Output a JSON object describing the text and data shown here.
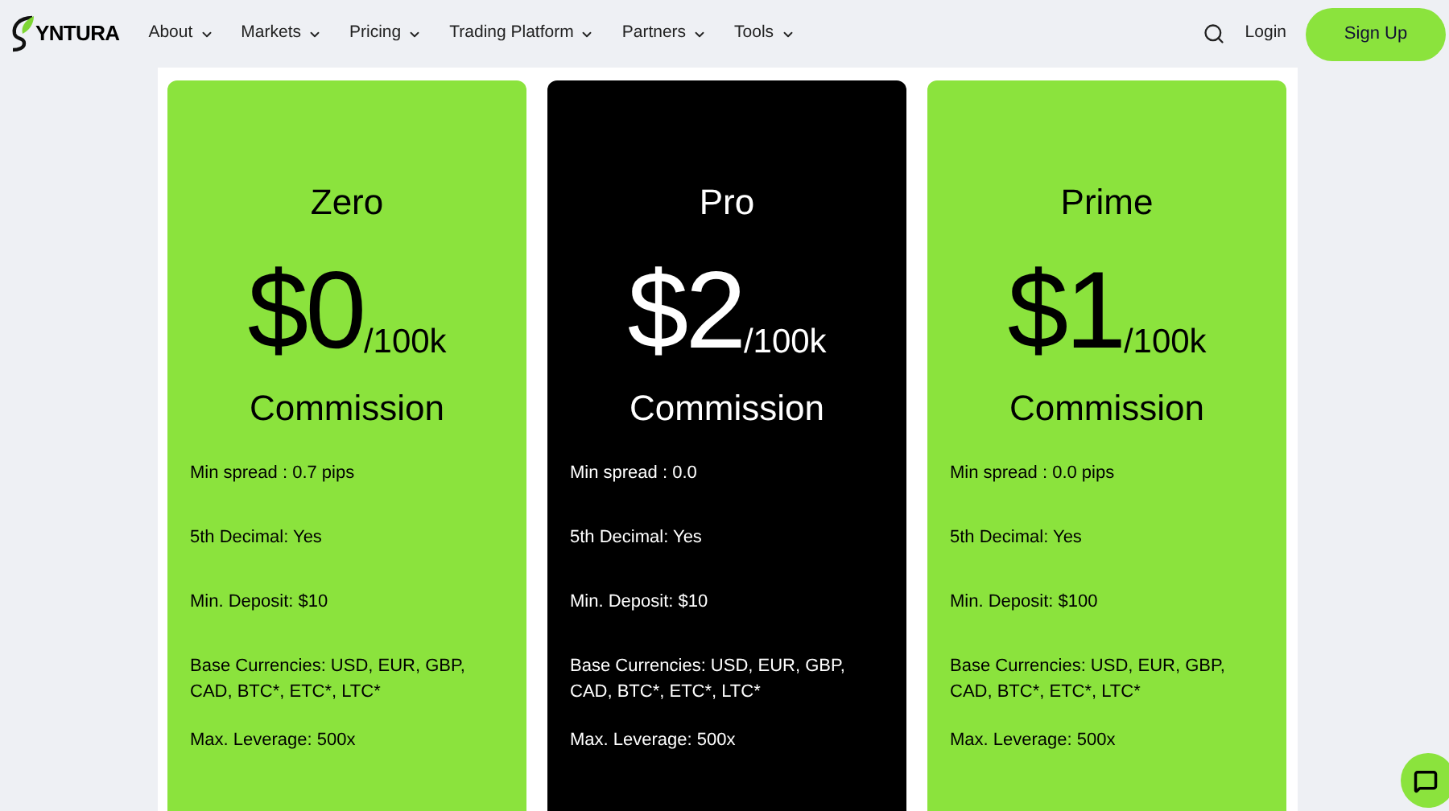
{
  "nav": {
    "logo": "YNTURA",
    "menu": [
      {
        "label": "About"
      },
      {
        "label": "Markets"
      },
      {
        "label": "Pricing"
      },
      {
        "label": "Trading Platform"
      },
      {
        "label": "Partners"
      },
      {
        "label": "Tools"
      }
    ],
    "login": "Login",
    "signup": "Sign Up"
  },
  "plans": [
    {
      "name": "Zero",
      "price": "$0",
      "unit": "/100k",
      "caption": "Commission",
      "featured": false,
      "features": [
        "Min spread : 0.7 pips",
        "5th Decimal: Yes",
        "Min. Deposit: $10",
        "Base Currencies: USD, EUR, GBP, CAD, BTC*, ETC*, LTC*",
        "Max. Leverage: 500x"
      ]
    },
    {
      "name": "Pro",
      "price": "$2",
      "unit": "/100k",
      "caption": "Commission",
      "featured": true,
      "features": [
        "Min spread : 0.0",
        "5th Decimal: Yes",
        "Min. Deposit: $10",
        "Base Currencies: USD, EUR, GBP, CAD, BTC*, ETC*, LTC*",
        "Max. Leverage: 500x"
      ]
    },
    {
      "name": "Prime",
      "price": "$1",
      "unit": "/100k",
      "caption": "Commission",
      "featured": false,
      "features": [
        "Min spread : 0.0 pips",
        "5th Decimal: Yes",
        "Min. Deposit: $100",
        "Base Currencies: USD, EUR, GBP, CAD, BTC*, ETC*, LTC*",
        "Max. Leverage: 500x"
      ]
    }
  ]
}
